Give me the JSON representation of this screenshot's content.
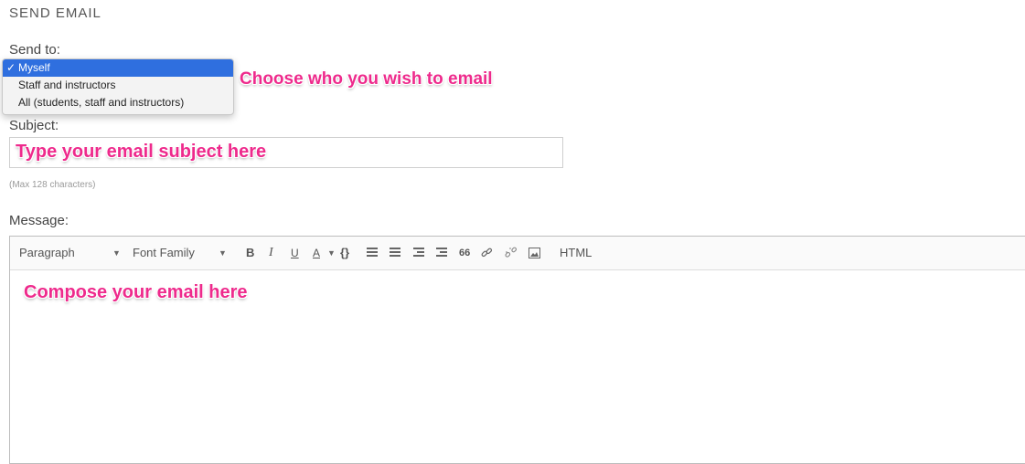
{
  "page": {
    "heading": "SEND EMAIL"
  },
  "send_to": {
    "label": "Send to:",
    "options": [
      "Myself",
      "Staff and instructors",
      "All (students, staff and instructors)"
    ],
    "selected_index": 0,
    "check_glyph": "✓"
  },
  "subject": {
    "label": "Subject:",
    "hint": "(Max 128 characters)"
  },
  "message": {
    "label": "Message:",
    "toolbar": {
      "block_format": "Paragraph",
      "font_family": "Font Family",
      "bold": "B",
      "italic": "I",
      "underline": "U",
      "text_color": "A",
      "code": "{}",
      "blockquote": "66",
      "html": "HTML"
    }
  },
  "annotations": {
    "send_to": "Choose who you wish to email",
    "subject": "Type your email subject here",
    "message": "Compose your email here"
  },
  "colors": {
    "annotation": "#ee2a8c",
    "selected_option": "#2f6fdf"
  },
  "icons": [
    "caret-down-icon",
    "bullet-list-icon",
    "numbered-list-icon",
    "outdent-icon",
    "indent-icon",
    "link-icon",
    "unlink-icon",
    "image-icon"
  ]
}
